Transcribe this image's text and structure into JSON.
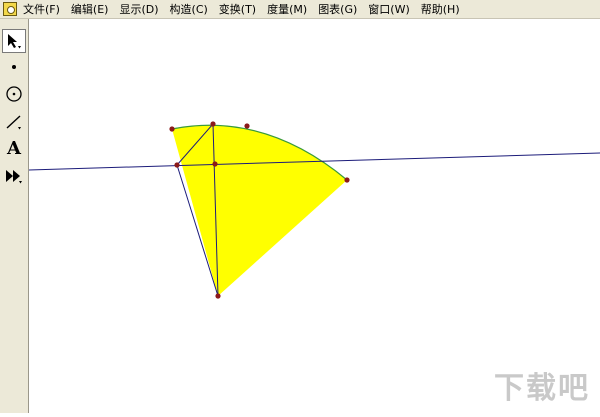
{
  "menu": {
    "items": [
      {
        "label": "文件(F)"
      },
      {
        "label": "编辑(E)"
      },
      {
        "label": "显示(D)"
      },
      {
        "label": "构造(C)"
      },
      {
        "label": "变换(T)"
      },
      {
        "label": "度量(M)"
      },
      {
        "label": "图表(G)"
      },
      {
        "label": "窗口(W)"
      },
      {
        "label": "帮助(H)"
      }
    ]
  },
  "toolbox": {
    "text_tool_glyph": "A"
  },
  "watermark": {
    "text": "下载吧"
  },
  "colors": {
    "sector_fill": "#ffff00",
    "arc_stroke": "#3a9a3a",
    "line_stroke": "#1c1c7a",
    "point_fill": "#8b1a1a",
    "chrome": "#ece9d8"
  }
}
